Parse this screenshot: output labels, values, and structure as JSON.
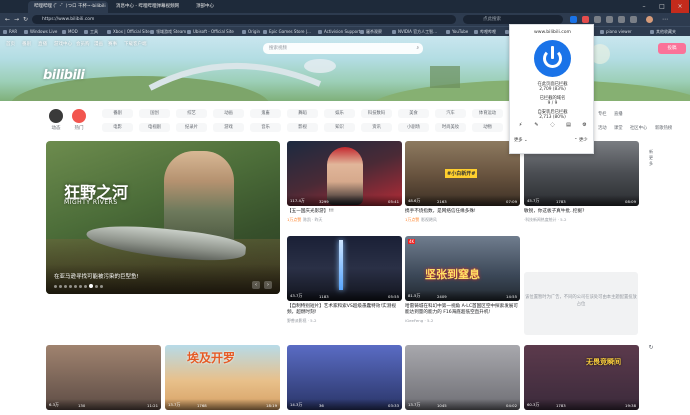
{
  "browser": {
    "tabs": [
      {
        "label": "哔哩哔哩 (゜-゜)つロ 干杯~-bilibili",
        "active": true
      },
      {
        "label": "消息中心 - 哔哩哔哩弹幕视频网",
        "active": false
      },
      {
        "label": "顶部中心",
        "active": false
      }
    ],
    "url": "https://www.bilibili.com",
    "search_placeholder": "点此搜索",
    "bookmarks": [
      "RAR",
      "Windows Live",
      "MOD",
      "工具",
      "Xbox | Official Site",
      "领域游戏 Steam",
      "Ubisoft - Official Site",
      "Origin",
      "Epic Games Store |...",
      "Activision Support",
      "屠杀观察",
      "NVIDIA 官方人工智...",
      "YouTube",
      "哔哩哔哩",
      "Bilibili",
      "piano viewer",
      "其他收藏夹"
    ]
  },
  "bilibili": {
    "nav": [
      "首页",
      "番剧",
      "直播",
      "游戏中心",
      "会员购",
      "漫画",
      "赛事",
      "下载客户端"
    ],
    "search_placeholder": "搜索视频",
    "upload": "投稿",
    "logo": "bilibili",
    "dynamic": "动态",
    "hot": "热门",
    "categories_row1": [
      "番剧",
      "国创",
      "综艺",
      "动画",
      "鬼畜",
      "舞蹈",
      "娱乐",
      "科技数码",
      "美食",
      "汽车",
      "体育运动"
    ],
    "categories_row2": [
      "电影",
      "电视剧",
      "纪录片",
      "游戏",
      "音乐",
      "影视",
      "知识",
      "资讯",
      "小剧场",
      "时尚美妆",
      "动物"
    ],
    "side_links_row1": [
      "专栏",
      "直播"
    ],
    "side_links_row2": [
      "活动",
      "课堂",
      "社区中心",
      "新歌热榜"
    ],
    "carousel": {
      "title": "狂野之河",
      "subtitle": "MIGHTY RIVERS",
      "caption": "在亚马逊寻找可能被污染的巨型鱼!",
      "dots": 10,
      "active_dot": 7
    },
    "cards": [
      {
        "title": "【五一国庆光影游】!!!",
        "meta": "陈凯 · 昨天",
        "tag": "",
        "views": "117.4万",
        "danmaku": "3299",
        "duration": "05:41",
        "thumb_color": "#b32b36",
        "label": ""
      },
      {
        "title": "携手不烧指数，是网络信任缘多殊!",
        "meta": "影视飓风",
        "tag": "",
        "views": "48.6万",
        "danmaku": "2163",
        "duration": "07:09",
        "thumb_color": "#6a5540",
        "label": "#小白新开#"
      },
      {
        "title": "敏锐，你这板子真牛批..挖掘?",
        "meta": "·科技新闻热度统计 · 5-2",
        "tag": "",
        "views": "45.7万",
        "danmaku": "1783",
        "duration": "08:09",
        "thumb_color": "#4a4d52",
        "label": ""
      },
      {
        "title": "【自制特别短片】艺术家和索VS超级愚蠢特效!实测视频，超燃时刻!",
        "meta": "野兽派影视 · 5-2",
        "tag": "",
        "views": "43.7万",
        "danmaku": "1183",
        "duration": "05:55",
        "thumb_color": "#2a3046",
        "label": ""
      },
      {
        "title": "哈雷铸城在科幻中第一视角 A-LC首国区空中探索发展可能达到量的能力的 F16海底超低空直升机!",
        "meta": "iGeeFeng · 5-2",
        "tag": "",
        "views": "81.5万",
        "danmaku": "2409",
        "duration": "14:55",
        "thumb_color": "#3c4858",
        "label": "坚张到窒息"
      }
    ],
    "ad_text": "该位置暂时为广告，不同的公司在该处可由本主题配置投放占位",
    "bottom_cards": [
      {
        "views": "6.3万",
        "danmaku": "130",
        "duration": "11:21",
        "thumb_color": "#5d4c45",
        "label": ""
      },
      {
        "views": "13.7万",
        "danmaku": "1768",
        "duration": "18:19",
        "thumb_color": "#d6a064",
        "label": "埃及开罗"
      },
      {
        "views": "14.3万",
        "danmaku": "36",
        "duration": "03:33",
        "thumb_color": "#2a3568",
        "label": ""
      },
      {
        "views": "13.7万",
        "danmaku": "1045",
        "duration": "04:02",
        "thumb_color": "#6e6e74",
        "label": ""
      },
      {
        "views": "60.3万",
        "danmaku": "1783",
        "duration": "19:38",
        "thumb_color": "#3b2a3b",
        "label": "无畏竞瞬间"
      }
    ],
    "side_tools": [
      "新",
      "更",
      "多"
    ],
    "refresh_label": "换"
  },
  "popup": {
    "site": "www.bilibili.com",
    "stats": [
      {
        "label": "在此页面已拦截",
        "value": "2,709 (83%)"
      },
      {
        "label": "已拦截的域名",
        "value": "9 / 9"
      },
      {
        "label": "自安装后已拦截",
        "value": "2,713 (80%)"
      }
    ],
    "more_left": "更多",
    "more_right": "更少"
  }
}
